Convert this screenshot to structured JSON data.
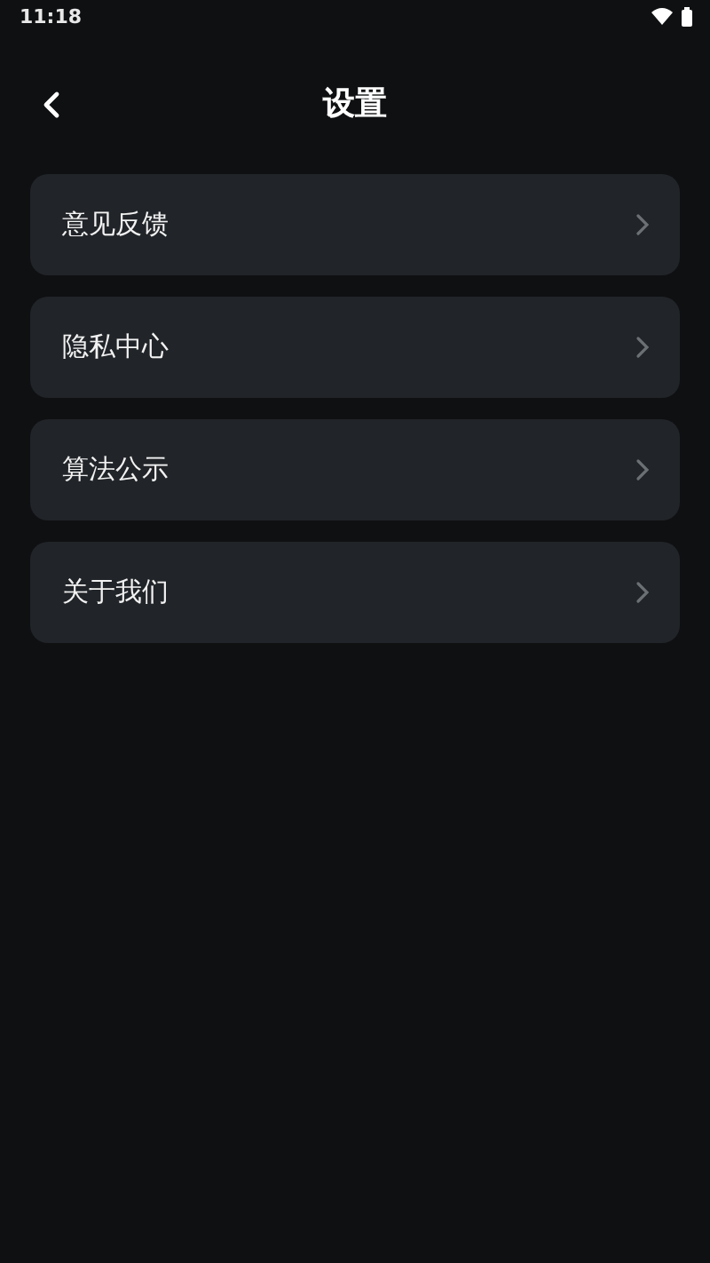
{
  "status_bar": {
    "time": "11:18"
  },
  "header": {
    "title": "设置"
  },
  "items": [
    {
      "label": "意见反馈"
    },
    {
      "label": "隐私中心"
    },
    {
      "label": "算法公示"
    },
    {
      "label": "关于我们"
    }
  ]
}
